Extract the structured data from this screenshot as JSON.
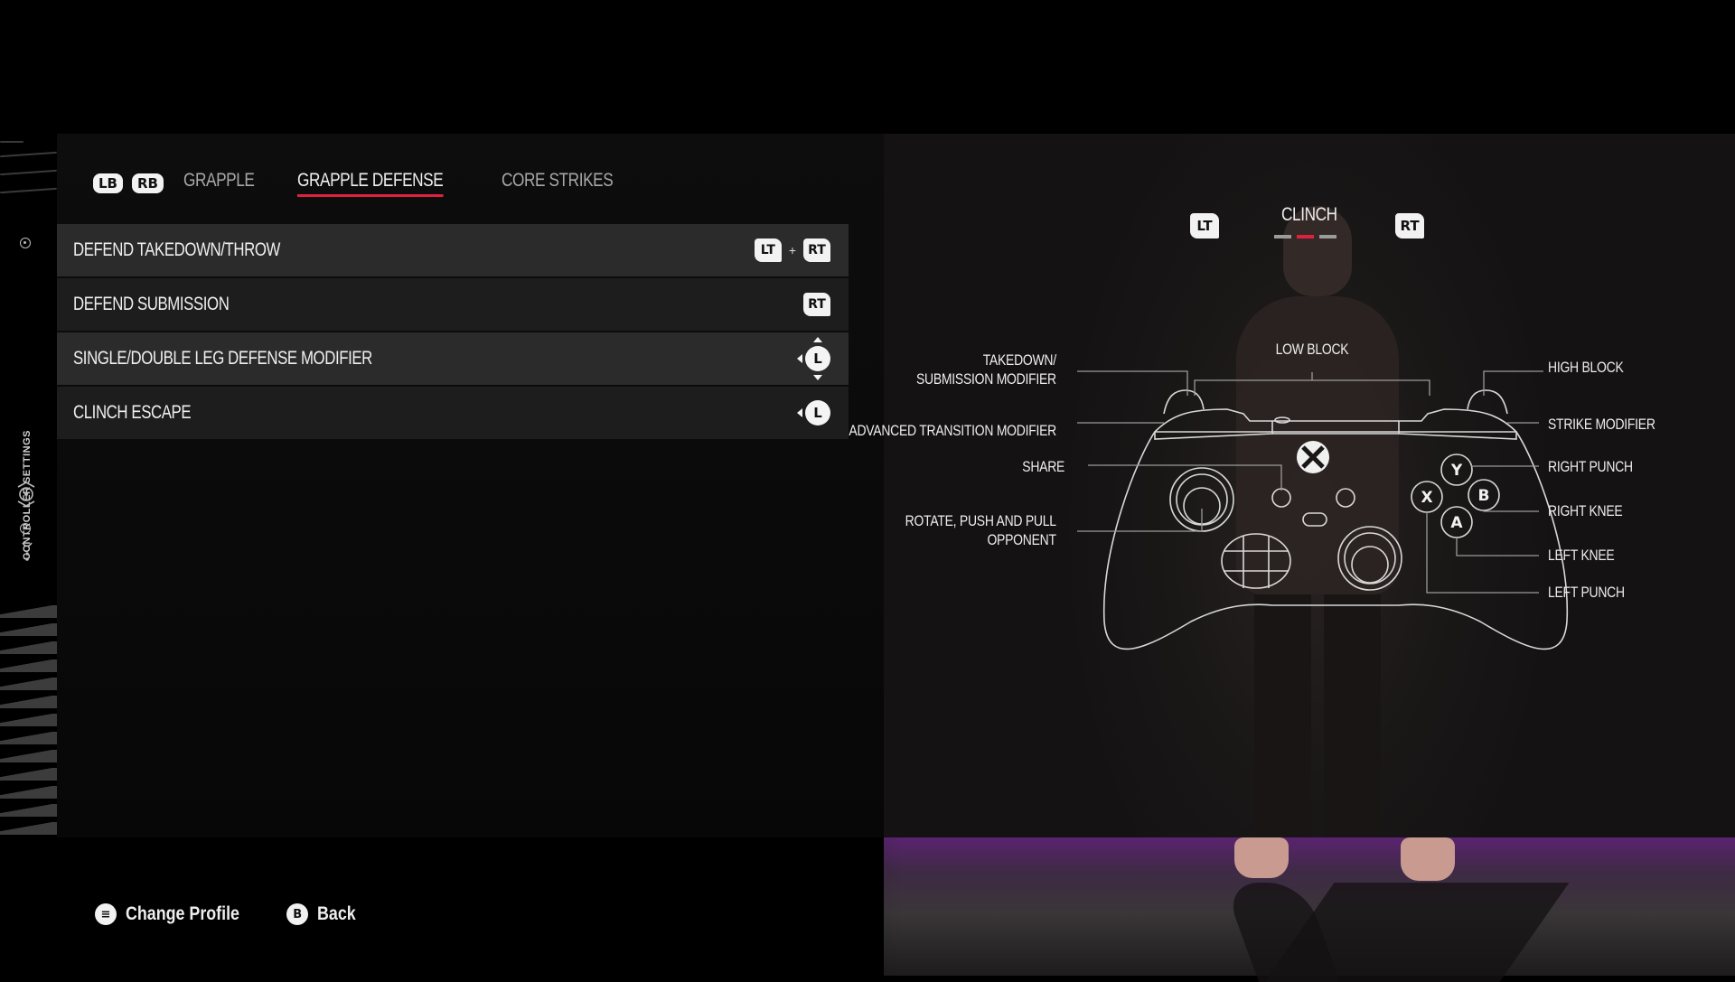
{
  "sidebar": {
    "title": "CONTROLLER SETTINGS",
    "icons": [
      "target-icon",
      "ufc-logo-icon",
      "target-icon",
      "more-icon"
    ]
  },
  "tabs": {
    "prev_bumper": "LB",
    "next_bumper": "RB",
    "items": [
      {
        "label": "GRAPPLE",
        "active": false
      },
      {
        "label": "GRAPPLE DEFENSE",
        "active": true
      },
      {
        "label": "CORE STRIKES",
        "active": false
      }
    ]
  },
  "actions": [
    {
      "label": "DEFEND TAKEDOWN/THROW",
      "binding": [
        "LT",
        "+",
        "RT"
      ]
    },
    {
      "label": "DEFEND SUBMISSION",
      "binding": [
        "RT"
      ]
    },
    {
      "label": "SINGLE/DOUBLE LEG DEFENSE MODIFIER",
      "binding": [
        "L-stick-left-up-down"
      ]
    },
    {
      "label": "CLINCH ESCAPE",
      "binding": [
        "L-stick-left"
      ]
    }
  ],
  "binding_text": {
    "lt": "LT",
    "rt": "RT",
    "plus": "+",
    "l": "L"
  },
  "controller": {
    "prev_trigger": "LT",
    "next_trigger": "RT",
    "mode": "CLINCH",
    "mode_pages": 3,
    "mode_active_index": 1,
    "labels": {
      "takedown_line1": "TAKEDOWN/",
      "takedown_line2": "SUBMISSION MODIFIER",
      "advanced": "ADVANCED TRANSITION MODIFIER",
      "share": "SHARE",
      "rotate_line1": "ROTATE, PUSH AND PULL",
      "rotate_line2": "OPPONENT",
      "low_block": "LOW BLOCK",
      "high_block": "HIGH BLOCK",
      "strike_modifier": "STRIKE MODIFIER",
      "right_punch": "RIGHT PUNCH",
      "right_knee": "RIGHT KNEE",
      "left_knee": "LEFT KNEE",
      "left_punch": "LEFT PUNCH"
    },
    "face_buttons": {
      "y": "Y",
      "b": "B",
      "x": "X",
      "a": "A"
    }
  },
  "colors": {
    "accent": "#e0203f",
    "floor_glow": "#5a2370"
  },
  "footer": {
    "change_profile_icon": "≡",
    "change_profile": "Change Profile",
    "back_icon": "B",
    "back": "Back"
  }
}
